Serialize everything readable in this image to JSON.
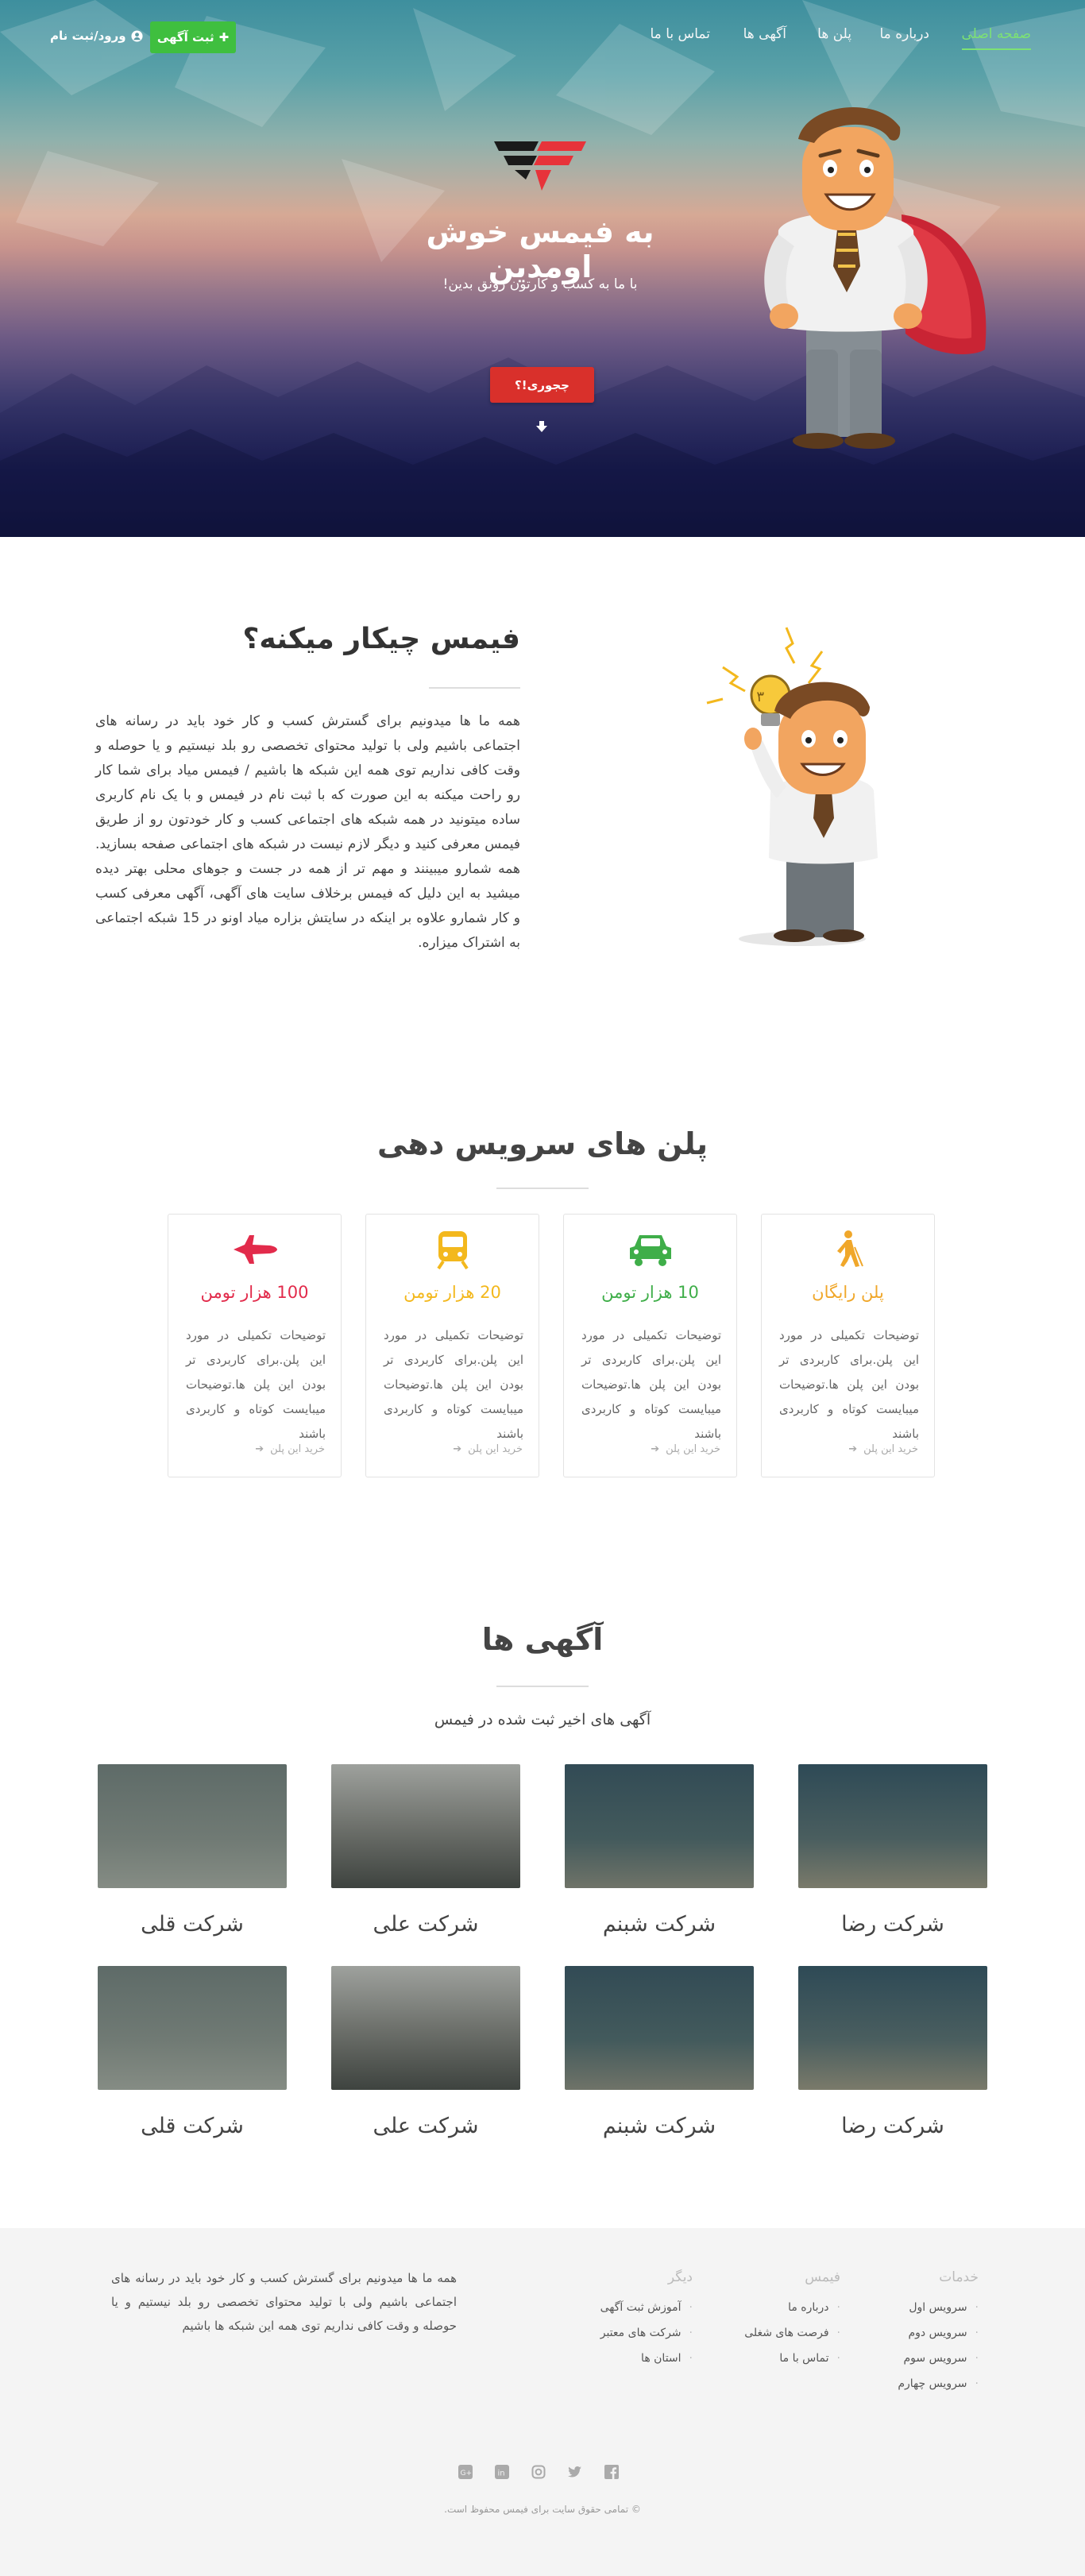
{
  "nav": {
    "items": [
      {
        "label": "صفحه اصلی",
        "active": true
      },
      {
        "label": "درباره ما",
        "active": false
      },
      {
        "label": "پلن ها",
        "active": false
      },
      {
        "label": "آگهی ها",
        "active": false
      },
      {
        "label": "تماس با ما",
        "active": false
      }
    ],
    "post_button": "ثبت آگهی",
    "login": "ورود/ثبت نام"
  },
  "hero": {
    "title": "به فیمس خوش اومدین",
    "subtitle": "با ما به کسب و کارتون رونق بدین!",
    "button": "چجوری!؟"
  },
  "about": {
    "title": "فیمس چیکار میکنه؟",
    "text": "همه ما ها میدونیم برای گسترش کسب و کار خود باید در رسانه های اجتماعی باشیم ولی با تولید محتوای تخصصی رو بلد نیستیم و یا حوصله و وقت کافی نداریم توی همه این شبکه ها باشیم / فیمس میاد برای شما کار رو راحت میکنه به این صورت که با ثبت نام در فیمس و با یک نام کاربری ساده میتونید در همه شبکه های اجتماعی کسب و کار خودتون رو از طریق فیمس معرفی کنید و دیگر لازم نیست در شبکه های اجتماعی صفحه بسازید. همه شمارو میبینند و مهم تر از همه در جست و جوهای محلی بهتر دیده میشید به این دلیل که فیمس برخلاف سایت های آگهی، آگهی معرفی کسب و کار شمارو علاوه بر اینکه در سایتش بزاره میاد اونو در 15 شبکه اجتماعی به اشتراک میزاره."
  },
  "plans": {
    "title": "پلن های سرویس دهی",
    "items": [
      {
        "name": "پلن رایگان",
        "color": "#f0a72a",
        "icon": "walking-person-icon",
        "desc": "توضیحات تکمیلی در مورد این پلن.برای کاربردی تر بودن این پلن ها.توضیحات میبایست کوتاه و کاربردی باشند",
        "buy": "خرید این پلن"
      },
      {
        "name": "10 هزار تومن",
        "color": "#3fae49",
        "icon": "car-icon",
        "desc": "توضیحات تکمیلی در مورد این پلن.برای کاربردی تر بودن این پلن ها.توضیحات میبایست کوتاه و کاربردی باشند",
        "buy": "خرید این پلن"
      },
      {
        "name": "20 هزار تومن",
        "color": "#f3b81d",
        "icon": "train-icon",
        "desc": "توضیحات تکمیلی در مورد این پلن.برای کاربردی تر بودن این پلن ها.توضیحات میبایست کوتاه و کاربردی باشند",
        "buy": "خرید این پلن"
      },
      {
        "name": "100 هزار تومن",
        "color": "#e22b4b",
        "icon": "jet-icon",
        "desc": "توضیحات تکمیلی در مورد این پلن.برای کاربردی تر بودن این پلن ها.توضیحات میبایست کوتاه و کاربردی باشند",
        "buy": "خرید این پلن"
      }
    ]
  },
  "ads": {
    "title": "آگهی ها",
    "subtitle": "آگهی های اخیر ثبت شده در فیمس",
    "items": [
      {
        "name": "شرکت رضا"
      },
      {
        "name": "شرکت شبنم"
      },
      {
        "name": "شرکت علی"
      },
      {
        "name": "شرکت قلی"
      },
      {
        "name": "شرکت رضا"
      },
      {
        "name": "شرکت شبنم"
      },
      {
        "name": "شرکت علی"
      },
      {
        "name": "شرکت قلی"
      }
    ]
  },
  "footer": {
    "columns": [
      {
        "heading": "خدمات",
        "items": [
          "سرویس اول",
          "سرویس دوم",
          "سرویس سوم",
          "سرویس چهارم"
        ]
      },
      {
        "heading": "فیمس",
        "items": [
          "درباره ما",
          "فرصت های شغلی",
          "تماس با ما"
        ]
      },
      {
        "heading": "دیگر",
        "items": [
          "آموزش ثبت آگهی",
          "شرکت های معتبر",
          "استان ها"
        ]
      }
    ],
    "text": "همه ما ها میدونیم برای گسترش کسب و کار خود باید در رسانه های اجتماعی باشیم ولی با تولید محتوای تخصصی رو بلد نیستیم و یا حوصله و وقت کافی نداریم توی همه این شبکه ها باشیم",
    "socials": [
      "google-plus-icon",
      "linkedin-icon",
      "instagram-icon",
      "twitter-icon",
      "facebook-icon"
    ],
    "copyright": "© تمامی حقوق سایت برای فیمس محفوظ است."
  }
}
